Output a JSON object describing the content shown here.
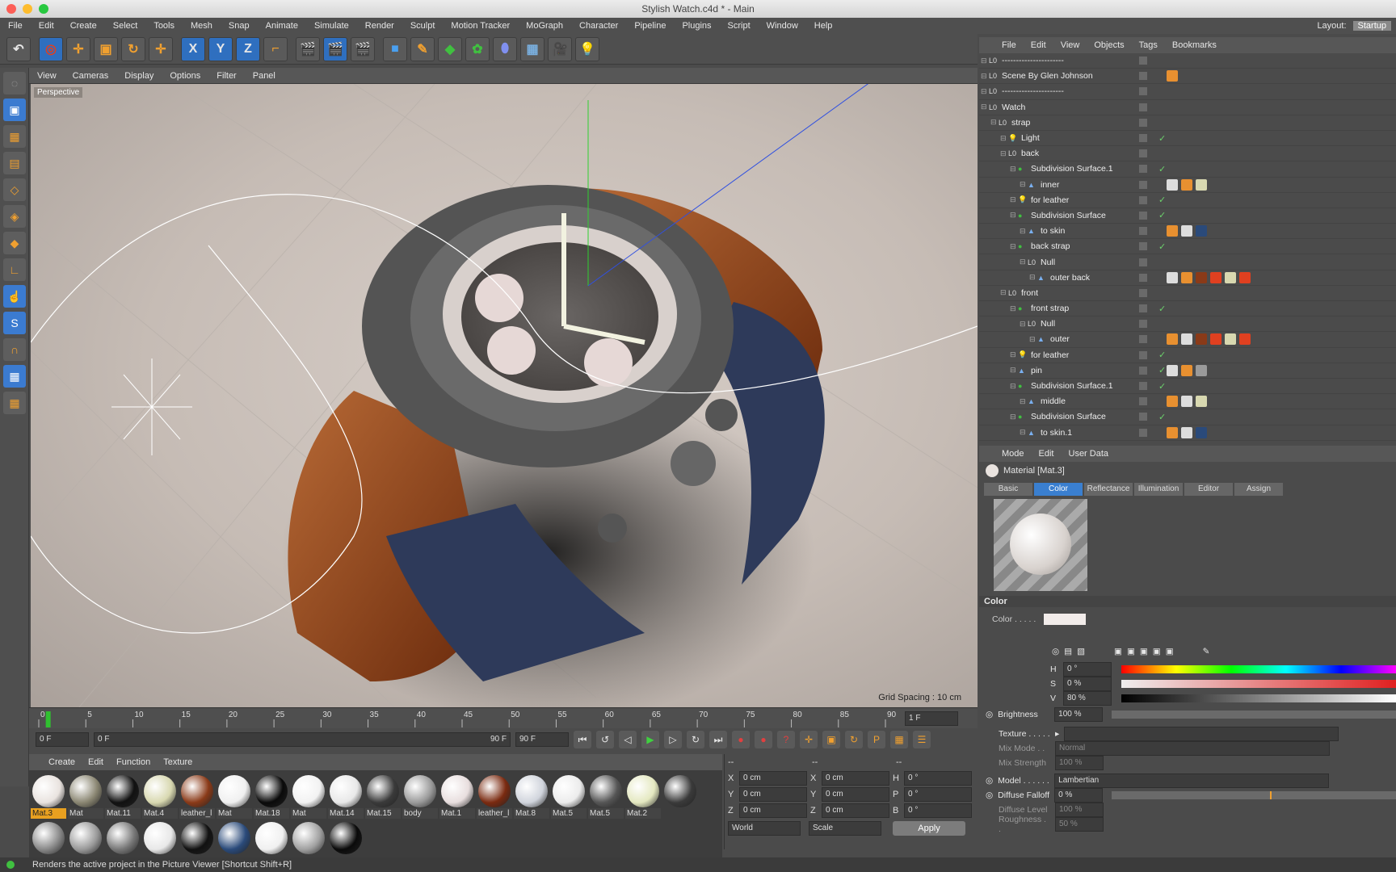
{
  "window": {
    "title": "Stylish Watch.c4d * - Main"
  },
  "menu": [
    "File",
    "Edit",
    "Create",
    "Select",
    "Tools",
    "Mesh",
    "Snap",
    "Animate",
    "Simulate",
    "Render",
    "Sculpt",
    "Motion Tracker",
    "MoGraph",
    "Character",
    "Pipeline",
    "Plugins",
    "Script",
    "Window",
    "Help"
  ],
  "layout": {
    "label": "Layout:",
    "value": "Startup"
  },
  "viewport": {
    "menu": [
      "View",
      "Cameras",
      "Display",
      "Options",
      "Filter",
      "Panel"
    ],
    "label": "Perspective",
    "grid_spacing": "Grid Spacing : 10 cm"
  },
  "timeline": {
    "ticks": [
      "0",
      "5",
      "10",
      "15",
      "20",
      "25",
      "30",
      "35",
      "40",
      "45",
      "50",
      "55",
      "60",
      "65",
      "70",
      "75",
      "80",
      "85",
      "90"
    ],
    "current": "1 F",
    "start": "0 F",
    "range_start": "0 F",
    "range_end": "90 F",
    "end": "90 F"
  },
  "material_manager": {
    "menu": [
      "Create",
      "Edit",
      "Function",
      "Texture"
    ],
    "row1": [
      {
        "name": "Mat.3",
        "color": "#e9e3df",
        "active": true
      },
      {
        "name": "Mat",
        "color": "#8a8672"
      },
      {
        "name": "Mat.11",
        "color": "#111111"
      },
      {
        "name": "Mat.4",
        "color": "#d8d8b0"
      },
      {
        "name": "leather_l",
        "color": "#8a3a18"
      },
      {
        "name": "Mat",
        "color": "#f0f0f0"
      },
      {
        "name": "Mat.18",
        "color": "#0a0a0a"
      },
      {
        "name": "Mat",
        "color": "#f2f2f2"
      },
      {
        "name": "Mat.14",
        "color": "#e8e8e8"
      },
      {
        "name": "Mat.15",
        "color": "#3a3a3a"
      },
      {
        "name": "body",
        "color": "#9a9a9a"
      },
      {
        "name": "Mat.1",
        "color": "#e8dede"
      },
      {
        "name": "leather_l",
        "color": "#7a2a10"
      },
      {
        "name": "Mat.8",
        "color": "#d0d4dc"
      },
      {
        "name": "Mat.5",
        "color": "#ececec"
      },
      {
        "name": "Mat.5",
        "color": "#555555"
      },
      {
        "name": "Mat.2",
        "color": "#e4e8c0"
      }
    ],
    "row2": [
      "#3a3a3a",
      "#888888",
      "#999999",
      "#777777",
      "#e8e8e8",
      "#111111",
      "#2a4a7a",
      "#f0f0f0",
      "#a0a0a0",
      "#0a0a0a"
    ]
  },
  "coordinates": {
    "header": [
      "--",
      "--",
      "--"
    ],
    "rows": [
      {
        "a": "X",
        "av": "0 cm",
        "b": "X",
        "bv": "0 cm",
        "c": "H",
        "cv": "0 °"
      },
      {
        "a": "Y",
        "av": "0 cm",
        "b": "Y",
        "bv": "0 cm",
        "c": "P",
        "cv": "0 °"
      },
      {
        "a": "Z",
        "av": "0 cm",
        "b": "Z",
        "bv": "0 cm",
        "c": "B",
        "cv": "0 °"
      }
    ],
    "mode1": "World",
    "mode2": "Scale",
    "apply": "Apply"
  },
  "status": "Renders the active project in the Picture Viewer [Shortcut Shift+R]",
  "object_manager": {
    "menu": [
      "File",
      "Edit",
      "View",
      "Objects",
      "Tags",
      "Bookmarks"
    ],
    "rows": [
      {
        "name": "----------------------",
        "depth": 0,
        "icon": "null",
        "tags": []
      },
      {
        "name": "Scene By Glen Johnson",
        "depth": 0,
        "icon": "null",
        "tags": [
          "#e89030"
        ]
      },
      {
        "name": "----------------------",
        "depth": 0,
        "icon": "null",
        "tags": []
      },
      {
        "name": "Watch",
        "depth": 0,
        "icon": "null",
        "tags": []
      },
      {
        "name": "strap",
        "depth": 1,
        "icon": "null",
        "tags": []
      },
      {
        "name": "Light",
        "depth": 2,
        "icon": "light",
        "check": true,
        "tags": []
      },
      {
        "name": "back",
        "depth": 2,
        "icon": "null",
        "tags": []
      },
      {
        "name": "Subdivision Surface.1",
        "depth": 3,
        "icon": "sds",
        "check": true,
        "tags": []
      },
      {
        "name": "inner",
        "depth": 4,
        "icon": "poly",
        "tags": [
          "#dddddd",
          "#e89030",
          "#d8d8b0"
        ]
      },
      {
        "name": "for leather",
        "depth": 3,
        "icon": "light",
        "check": true,
        "tags": []
      },
      {
        "name": "Subdivision Surface",
        "depth": 3,
        "icon": "sds",
        "check": true,
        "tags": []
      },
      {
        "name": "to skin",
        "depth": 4,
        "icon": "poly",
        "tags": [
          "#e89030",
          "#dddddd",
          "#2a4a7a"
        ]
      },
      {
        "name": "back strap",
        "depth": 3,
        "icon": "sds",
        "check": true,
        "tags": []
      },
      {
        "name": "Null",
        "depth": 4,
        "icon": "null",
        "tags": []
      },
      {
        "name": "outer back",
        "depth": 5,
        "icon": "poly",
        "tags": [
          "#dddddd",
          "#e89030",
          "#8a3a18",
          "#e04020",
          "#d8d8b0",
          "#e04020"
        ]
      },
      {
        "name": "front",
        "depth": 2,
        "icon": "null",
        "tags": []
      },
      {
        "name": "front strap",
        "depth": 3,
        "icon": "sds",
        "check": true,
        "tags": []
      },
      {
        "name": "Null",
        "depth": 4,
        "icon": "null",
        "tags": []
      },
      {
        "name": "outer",
        "depth": 5,
        "icon": "poly",
        "tags": [
          "#e89030",
          "#dddddd",
          "#8a3a18",
          "#e04020",
          "#d8d8b0",
          "#e04020"
        ]
      },
      {
        "name": "for leather",
        "depth": 3,
        "icon": "light",
        "check": true,
        "tags": []
      },
      {
        "name": "pin",
        "depth": 3,
        "icon": "poly",
        "check": true,
        "tags": [
          "#dddddd",
          "#e89030",
          "#9a9a9a"
        ]
      },
      {
        "name": "Subdivision Surface.1",
        "depth": 3,
        "icon": "sds",
        "check": true,
        "tags": []
      },
      {
        "name": "middle",
        "depth": 4,
        "icon": "poly",
        "tags": [
          "#e89030",
          "#dddddd",
          "#d8d8b0"
        ]
      },
      {
        "name": "Subdivision Surface",
        "depth": 3,
        "icon": "sds",
        "check": true,
        "tags": []
      },
      {
        "name": "to skin.1",
        "depth": 4,
        "icon": "poly",
        "tags": [
          "#e89030",
          "#dddddd",
          "#2a4a7a"
        ]
      }
    ]
  },
  "attributes": {
    "menu": [
      "Mode",
      "Edit",
      "User Data"
    ],
    "material": "Material [Mat.3]",
    "tabs": [
      "Basic",
      "Color",
      "Reflectance",
      "Illumination",
      "Editor",
      "Assign"
    ],
    "active_tab": "Color",
    "section": "Color",
    "color_label": "Color . . . . .",
    "h": "0 °",
    "s": "0 %",
    "v": "80 %",
    "brightness_label": "Brightness",
    "brightness": "100 %",
    "texture_label": "Texture . . . . .",
    "mixmode_label": "Mix Mode . .",
    "mixmode": "Normal",
    "mixstrength_label": "Mix Strength",
    "mixstrength": "100 %",
    "model_label": "Model . . . . . .",
    "model": "Lambertian",
    "falloff_label": "Diffuse Falloff",
    "falloff": "0 %",
    "level_label": "Diffuse Level",
    "level": "100 %",
    "rough_label": "Roughness . .",
    "rough": "50 %"
  }
}
